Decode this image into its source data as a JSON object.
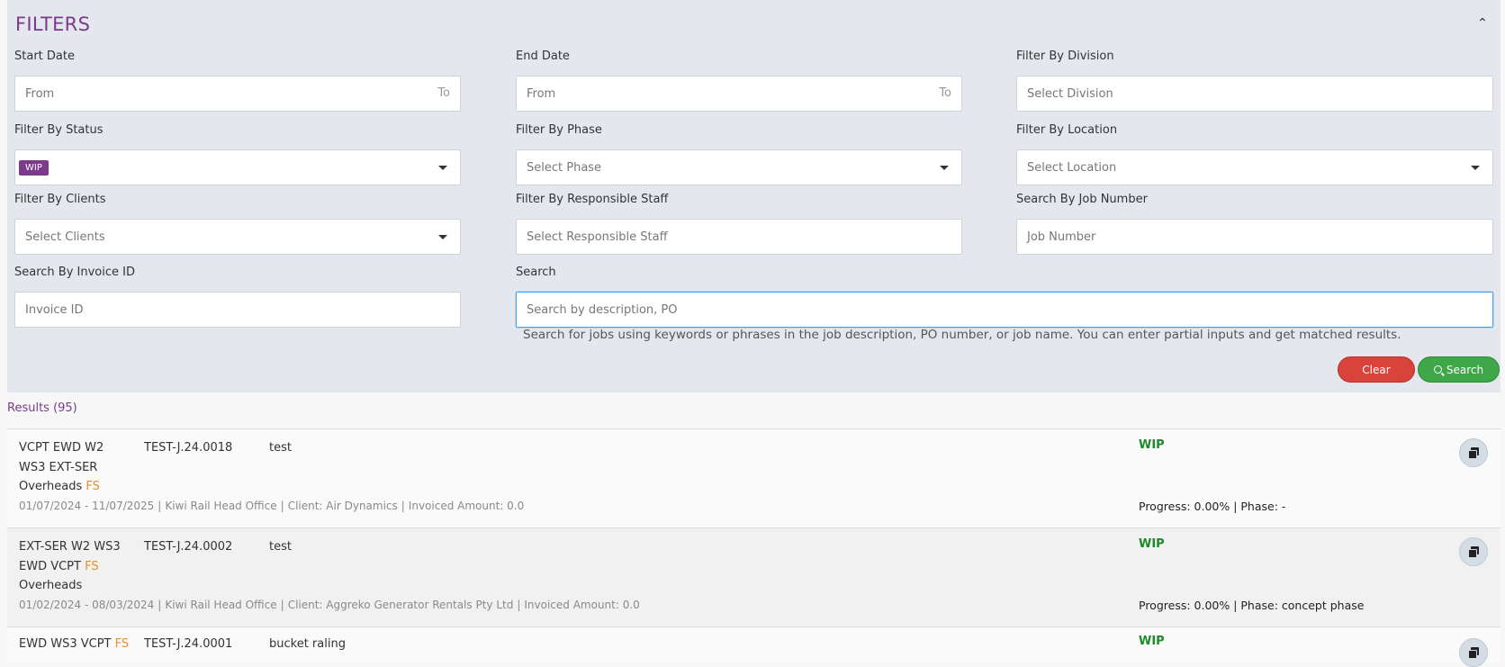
{
  "filters": {
    "title": "FILTERS",
    "start_date": {
      "label": "Start Date",
      "placeholder": "From",
      "suffix": "To"
    },
    "end_date": {
      "label": "End Date",
      "placeholder": "From",
      "suffix": "To"
    },
    "division": {
      "label": "Filter By Division",
      "placeholder": "Select Division"
    },
    "status": {
      "label": "Filter By Status",
      "selected_tag": "WIP"
    },
    "phase": {
      "label": "Filter By Phase",
      "placeholder": "Select Phase"
    },
    "location": {
      "label": "Filter By Location",
      "placeholder": "Select Location"
    },
    "clients": {
      "label": "Filter By Clients",
      "placeholder": "Select Clients"
    },
    "staff": {
      "label": "Filter By Responsible Staff",
      "placeholder": "Select Responsible Staff"
    },
    "job_number": {
      "label": "Search By Job Number",
      "placeholder": "Job Number"
    },
    "invoice_id": {
      "label": "Search By Invoice ID",
      "placeholder": "Invoice ID"
    },
    "search": {
      "label": "Search",
      "placeholder": "Search by description, PO",
      "help": "Search for jobs using keywords or phrases in the job description, PO number, or job name. You can enter partial inputs and get matched results."
    },
    "clear_label": "Clear",
    "search_label": "Search"
  },
  "results": {
    "label": "Results (95)",
    "rows": [
      {
        "name_lines": [
          "VCPT EWD W2",
          "WS3 EXT-SER",
          "Overheads"
        ],
        "fs": "FS",
        "job_number": "TEST-J.24.0018",
        "description": "test",
        "dates": "01/07/2024 - 11/07/2025",
        "office": "Kiwi Rail Head Office",
        "client": "Client: Air Dynamics",
        "invoiced": "Invoiced Amount: 0.0",
        "status": "WIP",
        "progress": "Progress: 0.00% | Phase: -"
      },
      {
        "name_lines": [
          "EXT-SER W2 WS3",
          "EWD VCPT",
          "Overheads"
        ],
        "fs": "FS",
        "job_number": "TEST-J.24.0002",
        "description": "test",
        "dates": "01/02/2024 - 08/03/2024",
        "office": "Kiwi Rail Head Office",
        "client": "Client: Aggreko Generator Rentals Pty Ltd",
        "invoiced": "Invoiced Amount: 0.0",
        "status": "WIP",
        "progress": "Progress: 0.00% | Phase: concept phase"
      },
      {
        "name_lines": [
          "EWD WS3 VCPT"
        ],
        "fs": "FS",
        "job_number": "TEST-J.24.0001",
        "description": "bucket raling",
        "status": "WIP"
      }
    ]
  }
}
